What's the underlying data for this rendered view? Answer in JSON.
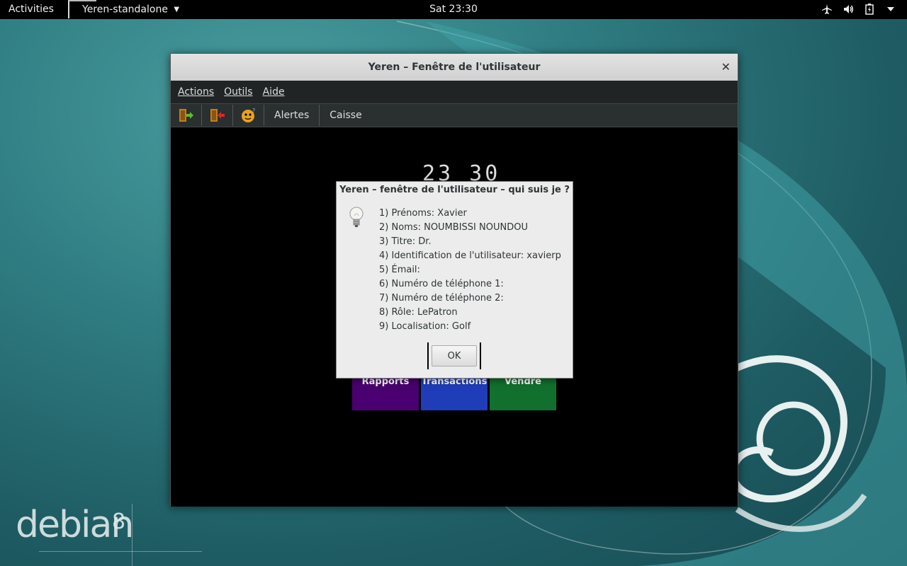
{
  "topbar": {
    "activities": "Activities",
    "app_name": "Yeren-standalone",
    "clock": "Sat 23:30",
    "tray_icons": [
      "airplane-icon",
      "volume-icon",
      "battery-icon",
      "system-menu-arrow-icon"
    ]
  },
  "desktop": {
    "logo_text": "debian",
    "logo_version": "8"
  },
  "window": {
    "title": "Yeren – Fenêtre de l'utilisateur",
    "menu": [
      "Actions",
      "Outils",
      "Aide"
    ],
    "toolbar": {
      "icons": [
        "exit-door-icon",
        "logout-door-icon",
        "who-am-i-face-icon"
      ],
      "buttons": [
        "Alertes",
        "Caisse"
      ]
    },
    "clock_display": "23 30",
    "tiles": [
      "Rapports",
      "Transactions",
      "Vendre"
    ],
    "colors": {
      "rapports": "#4a0070",
      "transactions": "#1f3db8",
      "vendre": "#12702e"
    }
  },
  "dialog": {
    "title": "Yeren – fenêtre de l'utilisateur – qui suis je ?",
    "icon": "lightbulb-icon",
    "lines": [
      "1) Prénoms: Xavier",
      "2) Noms: NOUMBISSI NOUNDOU",
      "3) Titre: Dr.",
      "4) Identification de l'utilisateur: xavierp",
      "5) Émail:",
      "6) Numéro de téléphone 1:",
      "7) Numéro de téléphone 2:",
      "8) Rôle: LePatron",
      "9) Localisation: Golf"
    ],
    "ok_label": "OK"
  }
}
